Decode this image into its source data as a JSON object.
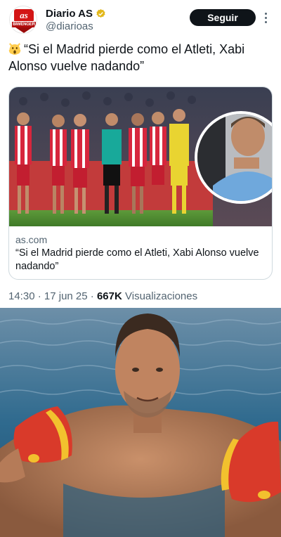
{
  "account": {
    "display_name": "Diario AS",
    "handle": "@diarioas",
    "avatar_logo_text": "as",
    "avatar_logo_subtext": "BIWENGER",
    "verified": true
  },
  "follow_button": {
    "label": "Seguir"
  },
  "tweet": {
    "emoji": "scream-emoji",
    "text": "“Si el Madrid pierde como el Atleti, Xabi Alonso vuelve nadando”"
  },
  "link_card": {
    "domain": "as.com",
    "title": "“Si el Madrid pierde como el Atleti, Xabi Alonso vuelve nadando”"
  },
  "meta": {
    "time": "14:30",
    "separator": "·",
    "date": "17 jun 25",
    "views_count": "667K",
    "views_label": "Visualizaciones"
  },
  "colors": {
    "accent": "#0f1419",
    "secondary_text": "#536471",
    "border": "#cfd9de",
    "verified_gold": "#e2b719"
  }
}
